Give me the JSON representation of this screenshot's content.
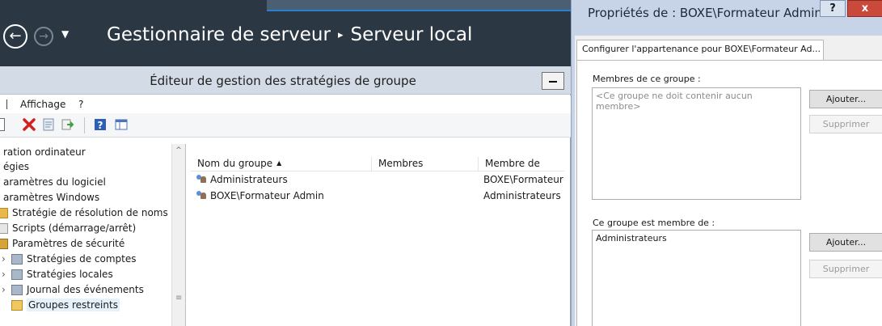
{
  "server_manager": {
    "title": "Gestionnaire de serveur",
    "separator": "▸",
    "page": "Serveur local"
  },
  "gpe": {
    "title": "Éditeur de gestion des stratégies de groupe",
    "menu": {
      "item1": "Affichage",
      "item2": "?"
    },
    "tree": {
      "items": [
        {
          "label": "ration ordinateur"
        },
        {
          "label": "égies"
        },
        {
          "label": "aramètres du logiciel"
        },
        {
          "label": "aramètres Windows"
        },
        {
          "label": "Stratégie de résolution de noms"
        },
        {
          "label": "Scripts (démarrage/arrêt)"
        },
        {
          "label": "Paramètres de sécurité"
        },
        {
          "label": "Stratégies de comptes",
          "expander": "›"
        },
        {
          "label": "Stratégies locales",
          "expander": "›"
        },
        {
          "label": "Journal des événements",
          "expander": "›"
        },
        {
          "label": "Groupes restreints"
        }
      ],
      "scroll_up": "^",
      "scroll_grip": "≡"
    },
    "list": {
      "columns": [
        "Nom du groupe",
        "Membres",
        "Membre de"
      ],
      "sort_arrow": "▲",
      "rows": [
        {
          "name": "Administrateurs",
          "members": "",
          "member_of": "BOXE\\Formateur Admin"
        },
        {
          "name": "BOXE\\Formateur Admin",
          "members": "",
          "member_of": "Administrateurs"
        }
      ]
    }
  },
  "dialog": {
    "title": "Propriétés de : BOXE\\Formateur Admin",
    "help": "?",
    "close": "x",
    "tab": "Configurer l'appartenance pour BOXE\\Formateur Ad...",
    "members_label": "Membres de ce groupe :",
    "members_placeholder": "<Ce groupe ne doit contenir aucun membre>",
    "add_label": "Ajouter...",
    "remove_label": "Supprimer",
    "memberof_label": "Ce groupe est membre de :",
    "memberof_items": [
      "Administrateurs"
    ]
  },
  "colors": {
    "banner_bg": "#2b3844",
    "dialog_frame": "#c7d4e8",
    "close_red": "#c94a3a",
    "delete_red": "#d22020"
  },
  "icons": [
    "back-arrow-icon",
    "forward-arrow-icon",
    "dropdown-arrow-icon",
    "minimize-icon",
    "delete-icon",
    "properties-icon",
    "export-icon",
    "help-icon",
    "view-icon",
    "group-icon",
    "folder-icon"
  ]
}
